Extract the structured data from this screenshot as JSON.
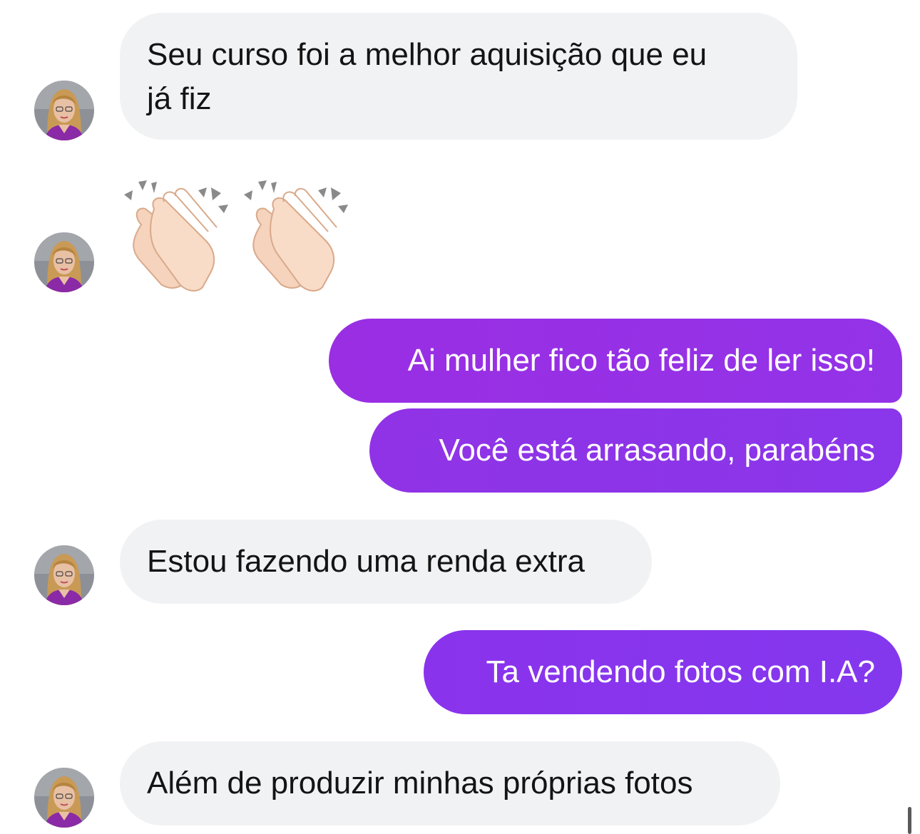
{
  "messages": [
    {
      "side": "incoming",
      "text_line1": "Seu curso foi a melhor aquisição que eu",
      "text_line2": "já fiz"
    },
    {
      "side": "incoming",
      "type": "emoji",
      "emoji": [
        "clapping-hands-icon",
        "clapping-hands-icon"
      ]
    },
    {
      "side": "outgoing",
      "text": "Ai mulher fico tão feliz de ler isso!"
    },
    {
      "side": "outgoing",
      "text": "Você está arrasando, parabéns"
    },
    {
      "side": "incoming",
      "text": "Estou fazendo uma renda extra"
    },
    {
      "side": "outgoing",
      "text": "Ta vendendo fotos com I.A?"
    },
    {
      "side": "incoming",
      "text": "Além de produzir minhas próprias fotos"
    }
  ],
  "colors": {
    "incoming_bubble": "#f1f2f4",
    "outgoing_bubble_start": "#9a2ee3",
    "outgoing_bubble_end": "#8438ee",
    "incoming_text": "#141414",
    "outgoing_text": "#ffffff"
  }
}
